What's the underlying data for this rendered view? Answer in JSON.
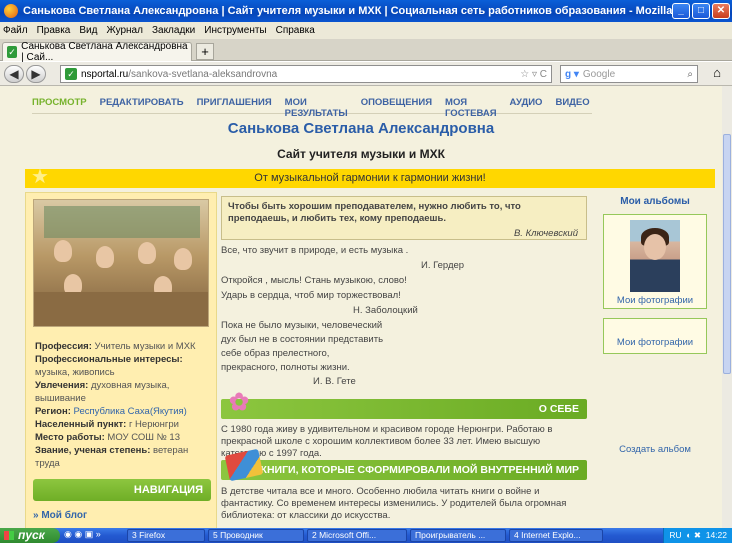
{
  "window": {
    "title": "Санькова Светлана Александровна | Сайт учителя музыки и МХК | Социальная сеть работников образования - Mozilla Firefox"
  },
  "menu": [
    "Файл",
    "Правка",
    "Вид",
    "Журнал",
    "Закладки",
    "Инструменты",
    "Справка"
  ],
  "tab": {
    "label": "Санькова Светлана Александровна | Сай..."
  },
  "url": {
    "domain": "nsportal.ru",
    "path": "/sankova-svetlana-aleksandrovna"
  },
  "search": {
    "placeholder": "Google"
  },
  "page_nav": [
    "ПРОСМОТР",
    "РЕДАКТИРОВАТЬ",
    "ПРИГЛАШЕНИЯ",
    "МОИ РЕЗУЛЬТАТЫ",
    "ОПОВЕЩЕНИЯ",
    "МОЯ ГОСТЕВАЯ",
    "АУДИО",
    "ВИДЕО"
  ],
  "header": {
    "name": "Санькова Светлана Александровна",
    "subtitle": "Сайт учителя музыки и МХК",
    "motto": "От музыкальной гармонии к гармонии жизни!"
  },
  "profile": {
    "profession_label": "Профессия:",
    "profession": "Учитель музыки и МХК",
    "interests_label": "Профессиональные интересы:",
    "interests": "музыка, живопись",
    "hobby_label": "Увлечения:",
    "hobby": "духовная музыка, вышивание",
    "region_label": "Регион:",
    "region": "Республика Саха(Якутия)",
    "city_label": "Населенный пункт:",
    "city": "г Нерюнгри",
    "work_label": "Место работы:",
    "work": "МОУ СОШ № 13",
    "rank_label": "Звание, ученая степень:",
    "rank": "ветеран труда"
  },
  "sidebar_nav": {
    "title": "НАВИГАЦИЯ",
    "link": "Мой блог"
  },
  "quote": {
    "text": "Чтобы быть хорошим преподавателем, нужно любить то, что преподаешь, и любить тех, кому преподаешь.",
    "author": "В. Ключевский"
  },
  "poems": [
    "Все, что звучит в природе, и есть музыка .",
    "И. Гердер",
    "Откройся , мысль! Стань музыкою, слово!",
    "Ударь в сердца, чтоб мир торжествовал!",
    "Н. Заболоцкий",
    "Пока не было музыки, человеческий",
    "дух был не в состоянии представить",
    "себе образ прелестного,",
    "прекрасного, полноты жизни.",
    "И. В. Гете"
  ],
  "about": {
    "title": "О СЕБЕ",
    "text": "С 1980 года живу в удивительном и красивом городе Нерюнгри. Работаю в прекрасной школе с хорошим коллективом более 33 лет. Имею высшую категорию с 1997 года."
  },
  "books": {
    "title": "КНИГИ, КОТОРЫЕ СФОРМИРОВАЛИ МОЙ ВНУТРЕННИЙ МИР",
    "text": "В детстве читала все и много. Особенно любила читать книги о войне и фантастику. Со временем интересы изменились. У родителей была огромная библиотека: от классики до искусства."
  },
  "albums": {
    "title": "Мои альбомы",
    "album1": "Мои фотографии",
    "album2": "Мои фотографии",
    "create": "Создать альбом"
  },
  "taskbar": {
    "start": "пуск",
    "items": [
      "3 Firefox",
      "5 Проводник",
      "2 Microsoft Offi...",
      "Проигрыватель ...",
      "4 Internet Explo..."
    ],
    "lang": "RU",
    "time": "14:22"
  }
}
